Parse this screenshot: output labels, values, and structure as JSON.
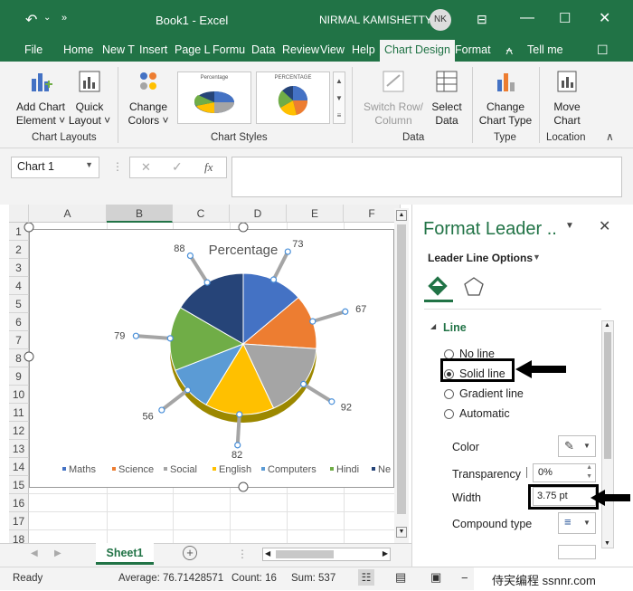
{
  "window": {
    "title": "Book1  -  Excel",
    "user_name": "NIRMAL KAMISHETTY",
    "user_initials": "NK"
  },
  "tabs": [
    "File",
    "Home",
    "New T",
    "Insert",
    "Page L",
    "Formu",
    "Data",
    "Review",
    "View",
    "Help",
    "Chart Design",
    "Format",
    "Tell me"
  ],
  "ribbon": {
    "add_chart_element": [
      "Add Chart",
      "Element ˅"
    ],
    "quick_layout": [
      "Quick",
      "Layout ˅"
    ],
    "change_colors": [
      "Change",
      "Colors ˅"
    ],
    "switch_row_column": [
      "Switch Row/",
      "Column"
    ],
    "select_data": [
      "Select",
      "Data"
    ],
    "change_chart_type": [
      "Change",
      "Chart Type"
    ],
    "move_chart": [
      "Move",
      "Chart"
    ],
    "groups": [
      "Chart Layouts",
      "Chart Styles",
      "Data",
      "Type",
      "Location"
    ],
    "style_thumb_titles": [
      "Percentage",
      "PERCENTAGE"
    ]
  },
  "formula_bar": {
    "name_box": "Chart 1",
    "fx": "fx"
  },
  "sheet": {
    "columns": [
      "A",
      "B",
      "C",
      "D",
      "E",
      "F"
    ],
    "rows": [
      "1",
      "2",
      "3",
      "4",
      "5",
      "6",
      "7",
      "8",
      "9",
      "10",
      "11",
      "12",
      "13",
      "14",
      "15",
      "16",
      "17",
      "18"
    ],
    "tab_name": "Sheet1"
  },
  "chart_data": {
    "type": "pie",
    "title": "Percentage",
    "categories": [
      "Maths",
      "Science",
      "Social",
      "English",
      "Computers",
      "Hindi",
      "Nepali"
    ],
    "legend_labels": [
      "Maths",
      "Science",
      "Social",
      "English",
      "Computers",
      "Hindi",
      "Ne"
    ],
    "values": [
      73,
      67,
      92,
      82,
      56,
      79,
      88
    ],
    "colors": [
      "#4472c4",
      "#ed7d31",
      "#a5a5a5",
      "#ffc000",
      "#5b9bd5",
      "#70ad47",
      "#264478"
    ],
    "legend_position": "bottom"
  },
  "status": {
    "ready": "Ready",
    "average": "Average: 76.71428571",
    "count": "Count: 16",
    "sum": "Sum: 537"
  },
  "format_pane": {
    "title": "Format Leader ..",
    "section": "Leader Line Options",
    "line_heading": "Line",
    "no_line": "No line",
    "solid_line": "Solid line",
    "gradient_line": "Gradient line",
    "automatic": "Automatic",
    "color_label": "Color",
    "transparency_label": "Transparency",
    "transparency_value": "0%",
    "width_label": "Width",
    "width_value": "3.75 pt",
    "compound_label": "Compound type"
  },
  "watermark": "侍宎编程 ssnnr.com"
}
